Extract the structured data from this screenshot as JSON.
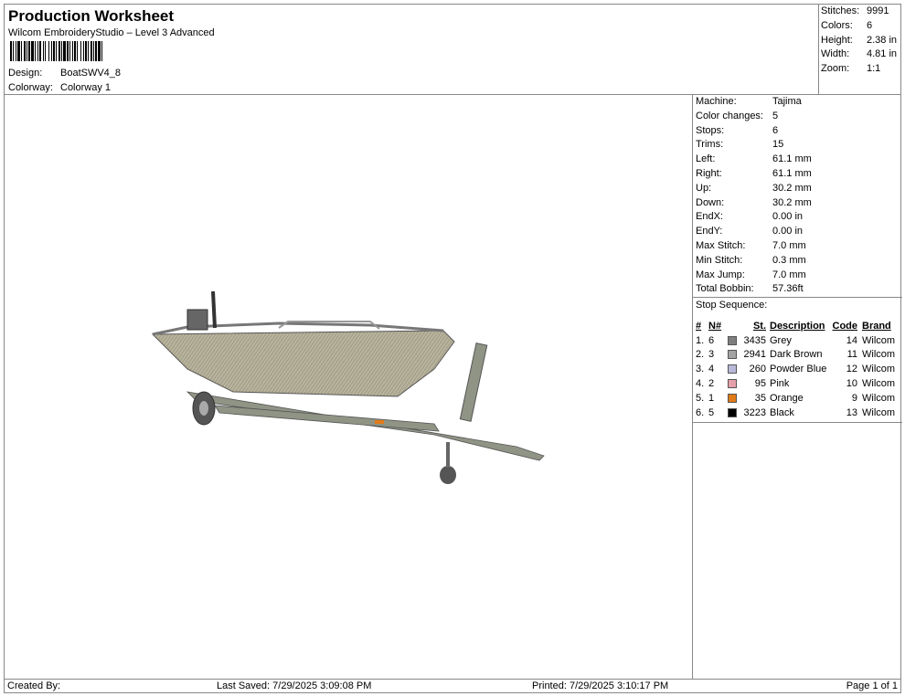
{
  "header": {
    "title": "Production Worksheet",
    "subtitle": "Wilcom EmbroideryStudio – Level 3 Advanced",
    "design_label": "Design:",
    "design": "BoatSWV4_8",
    "colorway_label": "Colorway:",
    "colorway": "Colorway 1"
  },
  "stats": [
    {
      "k": "Stitches:",
      "v": "9991"
    },
    {
      "k": "Colors:",
      "v": "6"
    },
    {
      "k": "Height:",
      "v": "2.38 in"
    },
    {
      "k": "Width:",
      "v": "4.81 in"
    },
    {
      "k": "Zoom:",
      "v": "1:1"
    }
  ],
  "machine": [
    {
      "k": "Machine:",
      "v": "Tajima"
    },
    {
      "k": "Color changes:",
      "v": "5"
    },
    {
      "k": "Stops:",
      "v": "6"
    },
    {
      "k": "Trims:",
      "v": "15"
    },
    {
      "k": "Left:",
      "v": "61.1 mm"
    },
    {
      "k": "Right:",
      "v": "61.1 mm"
    },
    {
      "k": "Up:",
      "v": "30.2 mm"
    },
    {
      "k": "Down:",
      "v": "30.2 mm"
    },
    {
      "k": "EndX:",
      "v": "0.00 in"
    },
    {
      "k": "EndY:",
      "v": "0.00 in"
    },
    {
      "k": "Max Stitch:",
      "v": "7.0 mm"
    },
    {
      "k": "Min Stitch:",
      "v": "0.3 mm"
    },
    {
      "k": "Max Jump:",
      "v": "7.0 mm"
    },
    {
      "k": "Total Bobbin:",
      "v": "57.36ft"
    }
  ],
  "stop_sequence": {
    "label": "Stop Sequence:",
    "headers": {
      "num": "#",
      "n": "N#",
      "st": "St.",
      "desc": "Description",
      "code": "Code",
      "brand": "Brand"
    },
    "rows": [
      {
        "num": "1.",
        "n": "6",
        "color": "#7f7f7f",
        "st": "3435",
        "desc": "Grey",
        "code": "14",
        "brand": "Wilcom"
      },
      {
        "num": "2.",
        "n": "3",
        "color": "#a3a3a3",
        "st": "2941",
        "desc": "Dark Brown",
        "code": "11",
        "brand": "Wilcom"
      },
      {
        "num": "3.",
        "n": "4",
        "color": "#b9b9d9",
        "st": "260",
        "desc": "Powder Blue",
        "code": "12",
        "brand": "Wilcom"
      },
      {
        "num": "4.",
        "n": "2",
        "color": "#e6a0aa",
        "st": "95",
        "desc": "Pink",
        "code": "10",
        "brand": "Wilcom"
      },
      {
        "num": "5.",
        "n": "1",
        "color": "#e07a18",
        "st": "35",
        "desc": "Orange",
        "code": "9",
        "brand": "Wilcom"
      },
      {
        "num": "6.",
        "n": "5",
        "color": "#000000",
        "st": "3223",
        "desc": "Black",
        "code": "13",
        "brand": "Wilcom"
      }
    ]
  },
  "footer": {
    "created": "Created By:",
    "saved": "Last Saved: 7/29/2025 3:09:08 PM",
    "printed": "Printed: 7/29/2025 3:10:17 PM",
    "page": "Page 1 of 1"
  }
}
